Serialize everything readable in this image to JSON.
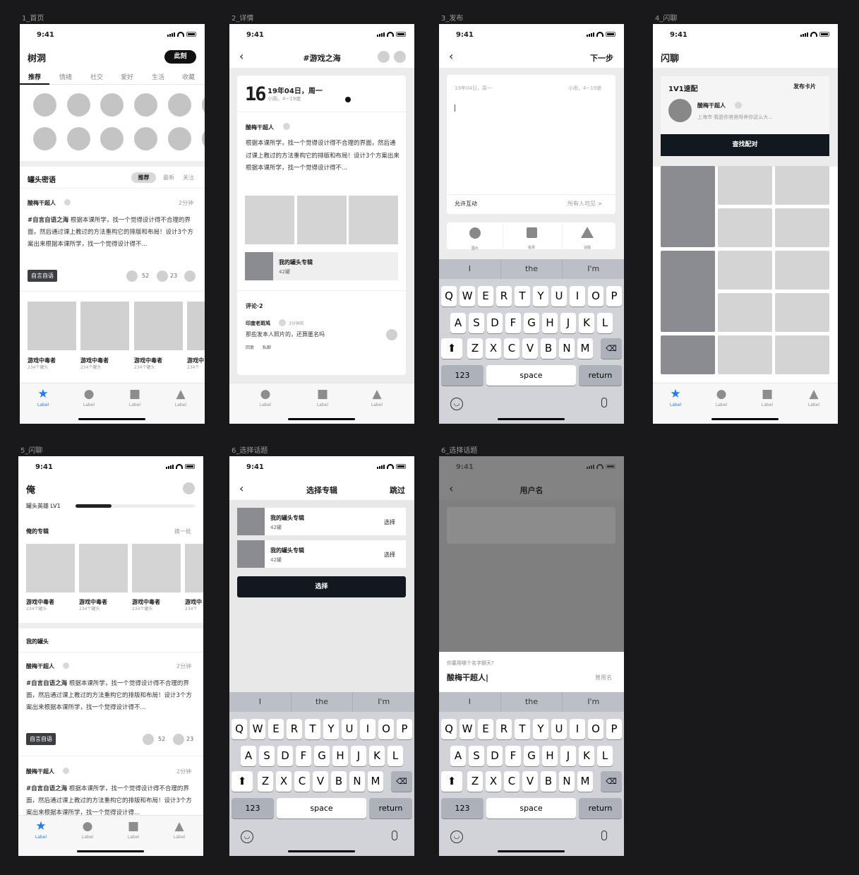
{
  "status": {
    "time": "9:41"
  },
  "frame_labels": [
    "1_首页",
    "2_详情",
    "3_发布",
    "4_闪聊",
    "5_闪聊",
    "6_选择话题",
    "6_选择话题"
  ],
  "tabbar": {
    "label": "Label"
  },
  "keyboard": {
    "suggestions": [
      "I",
      "the",
      "I'm"
    ],
    "row1": [
      "Q",
      "W",
      "E",
      "R",
      "T",
      "Y",
      "U",
      "I",
      "O",
      "P"
    ],
    "row2": [
      "A",
      "S",
      "D",
      "F",
      "G",
      "H",
      "J",
      "K",
      "L"
    ],
    "row3": [
      "Z",
      "X",
      "C",
      "V",
      "B",
      "N",
      "M"
    ],
    "num": "123",
    "space": "space",
    "ret": "return"
  },
  "home": {
    "title": "树洞",
    "cta": "此刻",
    "tabs": [
      "推荐",
      "情绪",
      "社交",
      "爱好",
      "生活",
      "收藏"
    ],
    "section": "罐头密语",
    "filters": [
      "推荐",
      "最新",
      "关注"
    ],
    "post": {
      "author": "酸梅干超人",
      "time": "2分钟",
      "tag": "#自言自语之海",
      "body": "根据本课所学，找一个觉得设计得不合理的界面，然后通过课上教过的方法重构它的排版和布局！设计3个方案出来根据本课所学，找一个觉得设计得不...",
      "chip": "自言自语",
      "likes": "52",
      "comments": "23"
    },
    "albums": [
      {
        "name": "游戏中毒者",
        "sub": "234个罐头"
      },
      {
        "name": "游戏中毒者",
        "sub": "234个罐头"
      },
      {
        "name": "游戏中毒者",
        "sub": "234个罐头"
      },
      {
        "name": "游戏中",
        "sub": "234个"
      }
    ]
  },
  "detail": {
    "title": "#游戏之海",
    "day": "16",
    "date": "19年04日，周一",
    "weather": "小雨，4~19度",
    "author": "酸梅干超人",
    "body": "根据本课所学，找一个觉得设计得不合理的界面，然后通过课上教过的方法重构它的排版和布局！设计3个方案出来根据本课所学，找一个觉得设计得不...",
    "album": "我的罐头专辑",
    "album_sub": "42罐",
    "comments_title": "评论·2",
    "c_author": "印度老斑鸠",
    "c_time": "3分钟前",
    "c_body": "那些发本人照片的，还算匿名吗",
    "reply": "回复",
    "dm": "私聊"
  },
  "publish": {
    "next": "下一步",
    "date": "19年04日，周一",
    "weather": "小雨，4~19度",
    "allow": "允许互动",
    "vis": "所有人可见 >",
    "tools": [
      "图片",
      "投票",
      "话题"
    ]
  },
  "flash": {
    "title": "闪聊",
    "card": "1V1速配",
    "publish": "发布卡片",
    "name": "酸梅干超人",
    "desc": "上海市·我是你爸爸呀养你这么大...",
    "match": "查找配对"
  },
  "me": {
    "title": "俺",
    "level": "罐头英雄 LV1",
    "progress": 0.3,
    "albums_title": "俺的专辑",
    "swap": "换一批",
    "albums": [
      {
        "name": "游戏中毒者",
        "sub": "234个罐头"
      },
      {
        "name": "游戏中毒者",
        "sub": "234个罐头"
      },
      {
        "name": "游戏中毒者",
        "sub": "234个罐头"
      },
      {
        "name": "游戏中",
        "sub": "234个"
      }
    ],
    "jars": "我的罐头",
    "post": {
      "author": "酸梅干超人",
      "time": "2分钟",
      "tag": "#自言自语之海",
      "body": "根据本课所学，找一个觉得设计得不合理的界面，然后通过课上教过的方法重构它的排版和布局！设计3个方案出来根据本课所学，找一个觉得设计得不...",
      "chip": "自言自语",
      "likes": "52",
      "comments": "23"
    },
    "post2": {
      "author": "酸梅干超人",
      "time": "2分钟",
      "tag": "#自言自语之海",
      "body": "根据本课所学，找一个觉得设计得不合理的界面，然后通过课上教过的方法重构它的排版和布局！设计3个方案出来根据本课所学，找一个觉得设计得..."
    }
  },
  "select": {
    "title": "选择专辑",
    "skip": "跳过",
    "items": [
      {
        "name": "我的罐头专辑",
        "sub": "42罐",
        "action": "选择"
      },
      {
        "name": "我的罐头专辑",
        "sub": "42罐",
        "action": "选择"
      }
    ],
    "confirm": "选择"
  },
  "username": {
    "title": "用户名",
    "prompt": "你要用哪个名字聊天?",
    "value": "酸梅干超人|",
    "used": "曾用名"
  }
}
